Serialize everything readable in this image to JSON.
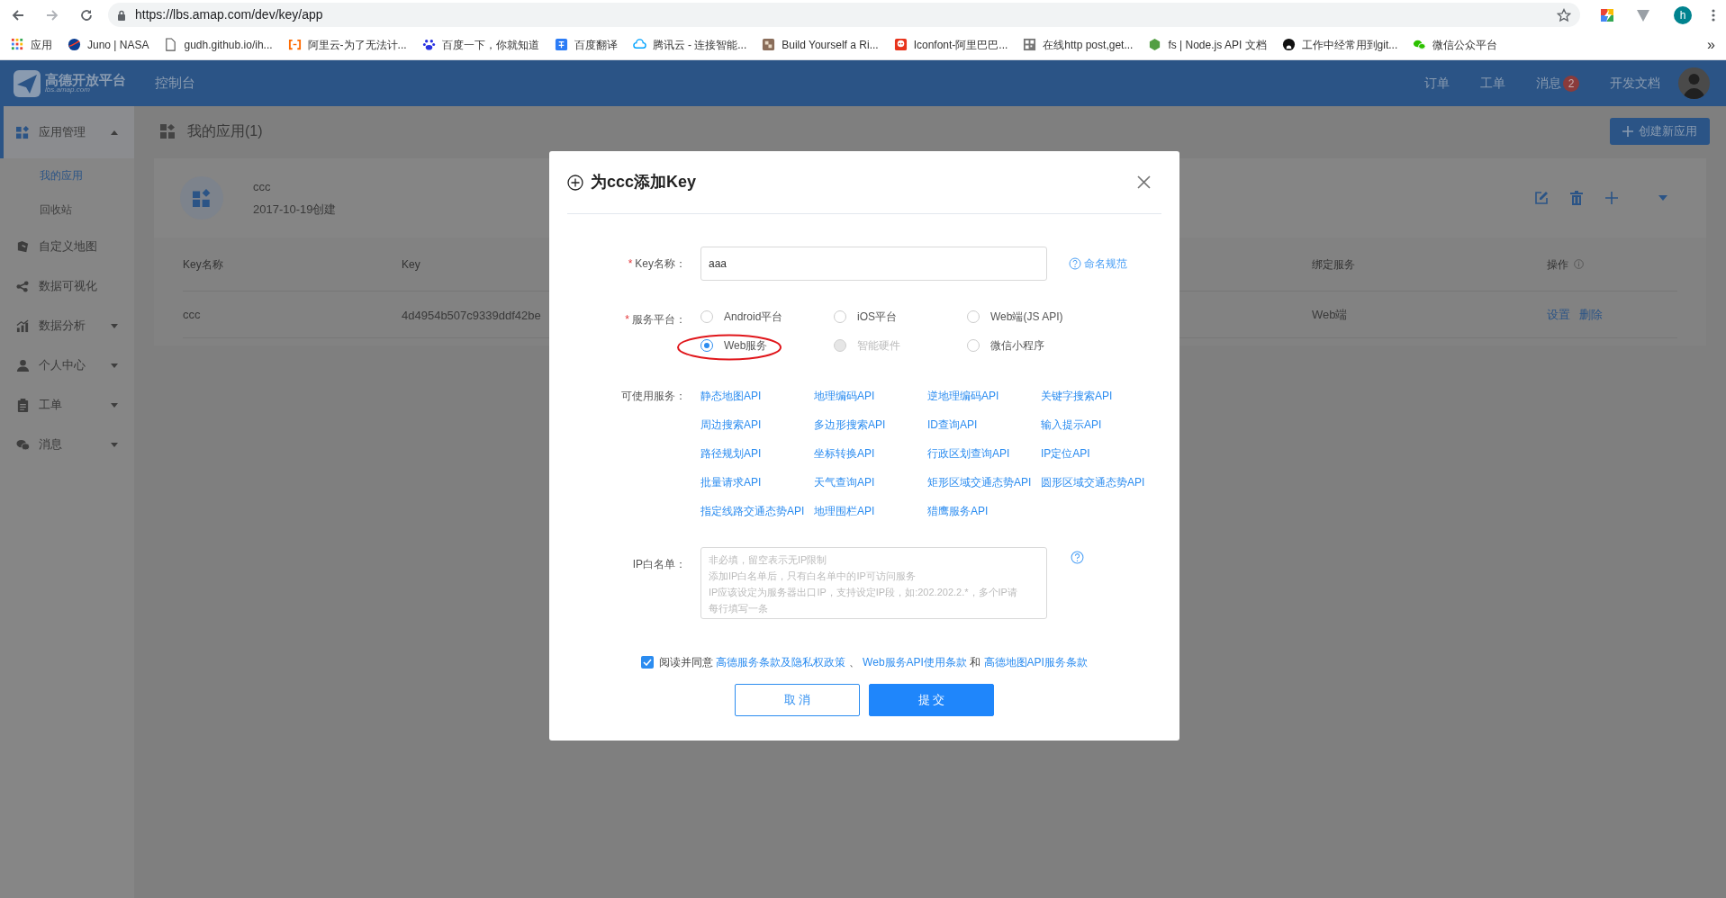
{
  "browser": {
    "url": "https://lbs.amap.com/dev/key/app",
    "profile_initial": "h",
    "more": "»",
    "bookmarks": [
      {
        "label": "应用"
      },
      {
        "label": "Juno | NASA"
      },
      {
        "label": "gudh.github.io/ih..."
      },
      {
        "label": "阿里云-为了无法计..."
      },
      {
        "label": "百度一下，你就知道"
      },
      {
        "label": "百度翻译"
      },
      {
        "label": "腾讯云 - 连接智能..."
      },
      {
        "label": "Build Yourself a Ri..."
      },
      {
        "label": "Iconfont-阿里巴巴..."
      },
      {
        "label": "在线http post,get..."
      },
      {
        "label": "fs | Node.js API 文档"
      },
      {
        "label": "工作中经常用到git..."
      },
      {
        "label": "微信公众平台"
      }
    ]
  },
  "header": {
    "logo_title": "高德开放平台",
    "logo_subtitle": "lbs.amap.com",
    "console": "控制台",
    "nav": [
      {
        "label": "订单"
      },
      {
        "label": "工单"
      },
      {
        "label": "消息",
        "badge": "2"
      },
      {
        "label": "开发文档"
      }
    ]
  },
  "sidebar": {
    "items": [
      {
        "label": "应用管理",
        "selected": true,
        "expanded": true,
        "children": [
          {
            "label": "我的应用",
            "selected": true
          },
          {
            "label": "回收站",
            "selected": false
          }
        ]
      },
      {
        "label": "自定义地图",
        "selected": false
      },
      {
        "label": "数据可视化",
        "selected": false
      },
      {
        "label": "数据分析",
        "selected": false,
        "expanded": false
      },
      {
        "label": "个人中心",
        "selected": false,
        "expanded": false
      },
      {
        "label": "工单",
        "selected": false,
        "expanded": false
      },
      {
        "label": "消息",
        "selected": false,
        "expanded": false
      }
    ]
  },
  "main": {
    "title": "我的应用(1)",
    "create_button": "创建新应用",
    "app": {
      "name": "ccc",
      "created": "2017-10-19创建"
    },
    "table": {
      "columns": [
        "Key名称",
        "Key",
        "绑定服务",
        "操作"
      ],
      "rows": [
        {
          "name": "ccc",
          "key": "4d4954b507c9339ddf42be",
          "service": "Web端",
          "actions": [
            "设置",
            "删除"
          ]
        }
      ]
    }
  },
  "dialog": {
    "title": "为ccc添加Key",
    "key_name": {
      "mark": "*",
      "label": "Key名称：",
      "value": "aaa",
      "help_link": "命名规范"
    },
    "platform": {
      "mark": "*",
      "label": "服务平台：",
      "options": [
        {
          "label": "Android平台",
          "selected": false,
          "disabled": false,
          "circled": false
        },
        {
          "label": "iOS平台",
          "selected": false,
          "disabled": false,
          "circled": false
        },
        {
          "label": "Web端(JS API)",
          "selected": false,
          "disabled": false,
          "circled": false
        },
        {
          "label": "Web服务",
          "selected": true,
          "disabled": false,
          "circled": true
        },
        {
          "label": "智能硬件",
          "selected": false,
          "disabled": true,
          "circled": false
        },
        {
          "label": "微信小程序",
          "selected": false,
          "disabled": false,
          "circled": false
        }
      ]
    },
    "services": {
      "label": "可使用服务：",
      "items": [
        "静态地图API",
        "地理编码API",
        "逆地理编码API",
        "关键字搜索API",
        "周边搜索API",
        "多边形搜索API",
        "ID查询API",
        "输入提示API",
        "路径规划API",
        "坐标转换API",
        "行政区划查询API",
        "IP定位API",
        "批量请求API",
        "天气查询API",
        "矩形区域交通态势API",
        "圆形区域交通态势API",
        "指定线路交通态势API",
        "地理围栏API",
        "猎鹰服务API"
      ]
    },
    "ip_whitelist": {
      "label": "IP白名单：",
      "placeholder_lines": [
        "非必填，留空表示无IP限制",
        "添加IP白名单后，只有白名单中的IP可访问服务",
        "IP应该设定为服务器出口IP，支持设定IP段，如:202.202.2.*，多个IP请",
        "每行填写一条"
      ]
    },
    "agreement": {
      "checked": true,
      "parts": [
        {
          "kind": "text",
          "text": "阅读并同意"
        },
        {
          "kind": "link",
          "text": "高德服务条款及隐私权政策"
        },
        {
          "kind": "text",
          "text": "、"
        },
        {
          "kind": "link",
          "text": "Web服务API使用条款"
        },
        {
          "kind": "text",
          "text": "和"
        },
        {
          "kind": "link",
          "text": "高德地图API服务条款"
        }
      ]
    },
    "buttons": [
      {
        "label": "取 消",
        "kind": "secondary"
      },
      {
        "label": "提 交",
        "kind": "primary"
      }
    ]
  }
}
